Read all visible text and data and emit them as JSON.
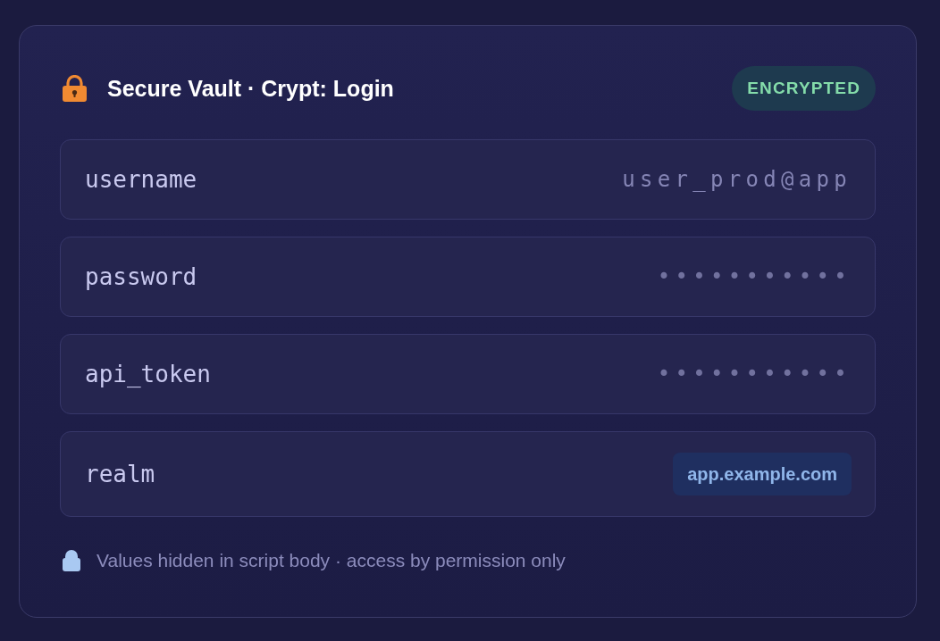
{
  "header": {
    "title": "Secure Vault · Crypt: Login",
    "badge": "ENCRYPTED"
  },
  "fields": [
    {
      "kind": "text",
      "label": "username",
      "value": "user_prod@app"
    },
    {
      "kind": "masked",
      "label": "password",
      "value": "•••••••••••"
    },
    {
      "kind": "masked",
      "label": "api_token",
      "value": "•••••••••••"
    },
    {
      "kind": "chip",
      "label": "realm",
      "value": "app.example.com"
    }
  ],
  "footer": {
    "note": "Values hidden in script body · access by permission only"
  }
}
